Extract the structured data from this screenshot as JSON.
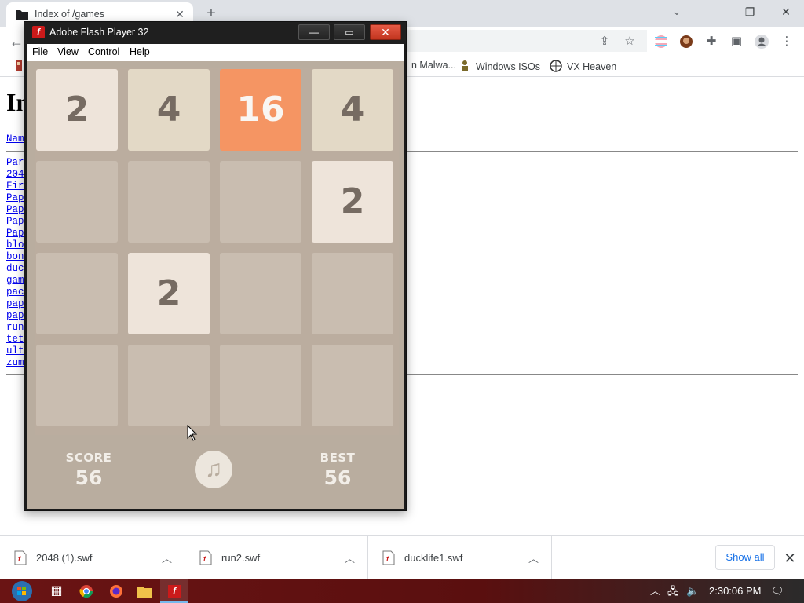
{
  "browser": {
    "tab_title": "Index of /games",
    "new_tab": "+",
    "tab_close": "✕",
    "window_controls": {
      "minimize": "—",
      "restore": "❐",
      "close": "✕"
    },
    "bookmarks": [
      {
        "label": "n Malwa...",
        "icon": "bookmark-icon"
      },
      {
        "label": "Windows ISOs",
        "icon": "person-icon"
      },
      {
        "label": "VX Heaven",
        "icon": "globe-icon"
      }
    ],
    "page": {
      "heading": "In",
      "name_link": "Nam",
      "links": [
        "Par",
        "204",
        "Fir",
        "Pap",
        "Pap",
        "Pap",
        "Pap",
        "blo",
        "bon",
        "duc",
        "gam",
        "pac",
        "pap",
        "pap",
        "run",
        "tet",
        "ult",
        "zum"
      ]
    },
    "downloads": [
      {
        "name": "2048 (1).swf"
      },
      {
        "name": "run2.swf"
      },
      {
        "name": "ducklife1.swf"
      }
    ],
    "show_all": "Show all",
    "dl_close": "✕"
  },
  "taskbar": {
    "clock": "2:30:06 PM"
  },
  "flash": {
    "title": "Adobe Flash Player 32",
    "logo": "f",
    "buttons": {
      "minimize": "—",
      "maximize": "▭",
      "close": "✕"
    },
    "menu": [
      "File",
      "View",
      "Control",
      "Help"
    ],
    "game": {
      "grid": [
        [
          "2",
          "4",
          "16",
          "4"
        ],
        [
          "",
          "",
          "",
          "2"
        ],
        [
          "",
          "2",
          "",
          ""
        ],
        [
          "",
          "",
          "",
          ""
        ]
      ],
      "score_label": "SCORE",
      "score_value": "56",
      "best_label": "BEST",
      "best_value": "56",
      "music_icon": "♫"
    }
  },
  "colors": {
    "tile_2": "#eee4da",
    "tile_4": "#e3d9c6",
    "tile_16": "#f59563",
    "tile_empty": "#c9bdb0",
    "board_bg": "#b9ad9f"
  }
}
